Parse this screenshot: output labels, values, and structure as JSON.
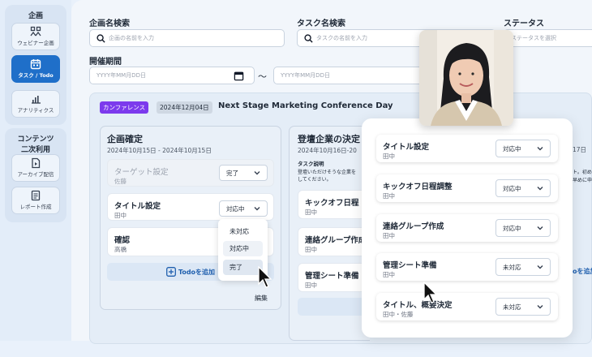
{
  "sidebar": {
    "group1_title": "企画",
    "items": [
      {
        "label": "ウェビナー企画",
        "icon": "webinar-icon"
      },
      {
        "label": "タスク / Todo",
        "icon": "calendar-icon",
        "active": true
      },
      {
        "label": "アナリティクス",
        "icon": "analytics-icon"
      }
    ],
    "group2_title_line1": "コンテンツ",
    "group2_title_line2": "二次利用",
    "items2": [
      {
        "label": "アーカイブ配信",
        "icon": "archive-icon"
      },
      {
        "label": "レポート作成",
        "icon": "report-icon"
      }
    ]
  },
  "filters": {
    "project_label": "企画名検索",
    "project_placeholder": "企画の名前を入力",
    "task_label": "タスク名検索",
    "task_placeholder": "タスクの名前を入力",
    "status_label": "ステータス",
    "status_placeholder": "ステータスを選択",
    "period_label": "開催期間",
    "date_placeholder_start": "YYYY年MM月DD日",
    "date_placeholder_end": "YYYY年MM月DD日",
    "tilde": "〜"
  },
  "event": {
    "tag": "カンファレンス",
    "date": "2024年12月04日",
    "title": "Next Stage Marketing Conference Day"
  },
  "column1": {
    "title": "企画確定",
    "dates": "2024年10月15日 - 2024年10月15日",
    "todos": [
      {
        "title": "ターゲット設定",
        "assignee": "佐藤",
        "status": "完了"
      },
      {
        "title": "タイトル設定",
        "assignee": "田中",
        "status": "対応中"
      },
      {
        "title": "確認",
        "assignee": "高橋"
      }
    ],
    "add_label": "Todoを追加",
    "edit_label": "編集"
  },
  "dropdown": {
    "options": [
      "未対応",
      "対応中",
      "完了"
    ]
  },
  "column2": {
    "title": "登壇企業の決定",
    "dates": "2024年10月16日-20",
    "desc_label": "タスク説明",
    "desc_line1": "登壇いただけそうな企業を",
    "desc_line2": "してください。",
    "todos": [
      {
        "title": "キックオフ日程",
        "assignee": "田中"
      },
      {
        "title": "連絡グループ作成",
        "assignee": "田中"
      },
      {
        "title": "管理シート準備",
        "assignee": "田中"
      }
    ]
  },
  "column3": {
    "dates_fragment": "17日",
    "desc_fragment1": "ト。初め",
    "desc_fragment2": "早めに申",
    "add_fragment": "oを追加"
  },
  "card": {
    "rows": [
      {
        "title": "タイトル設定",
        "assignee": "田中",
        "status": "対応中"
      },
      {
        "title": "キックオフ日程調整",
        "assignee": "田中",
        "status": "対応中"
      },
      {
        "title": "連絡グループ作成",
        "assignee": "田中",
        "status": "対応中"
      },
      {
        "title": "管理シート準備",
        "assignee": "田中",
        "status": "未対応"
      },
      {
        "title": "タイトル、概要決定",
        "assignee": "田中・佐藤",
        "status": "未対応"
      }
    ]
  },
  "colors": {
    "accent": "#1f6fc9",
    "tag_purple": "#7c3aed"
  }
}
